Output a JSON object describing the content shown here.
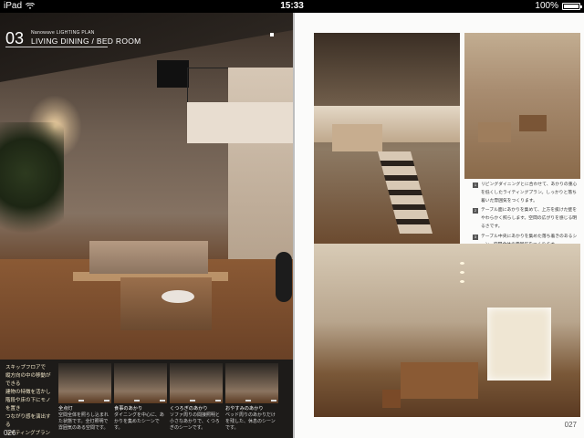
{
  "status_bar": {
    "device": "iPad",
    "time": "15:33",
    "battery": "100%",
    "battery_level": 1.0
  },
  "left_page": {
    "section_number": "03",
    "section_small": "Nanowave LIGHTING PLAN",
    "section_title": "LIVING DINING / BED ROOM",
    "caption": "スキップフロアで\n縦方向の中の移動ができる\n建物の特徴を活かし\n階段や床の下にモノを置き\nつながり感を演出する\nライティングプランです",
    "thumbnails": [
      {
        "caption_title": "全点灯",
        "caption_text": "空間全体を照らし込まれた状態です。全灯照明で雰囲気のある空間です。"
      },
      {
        "caption_title": "食事のあかり",
        "caption_text": "ダイニングを中心に、あかりを集めたシーンです。"
      },
      {
        "caption_title": "くつろぎのあかり",
        "caption_text": "ソファ周りの間接照明と小さなあかりで、くつろぎのシーンです。"
      },
      {
        "caption_title": "おやすみのあかり",
        "caption_text": "ベッド周りのあかりだけを残した、休息のシーンです。"
      }
    ],
    "page_number": "026"
  },
  "right_page": {
    "notes": [
      {
        "marker": "1",
        "text": "リビングダイニングとに合わせて、あかりの重心を低くしたライティングプラン。しっかりと落ち着いた雰囲気をつくります。"
      },
      {
        "marker": "2",
        "text": "テーブル面にあかりを集めて、上方を抜けた壁をやわらかく照らします。空間の広がりを感じる明るさです。"
      },
      {
        "marker": "3",
        "text": "テーブル中央にあかりを集めた落ち着きのあるシーン。空間全体の雰囲気をつくります。"
      }
    ],
    "page_number": "027"
  }
}
